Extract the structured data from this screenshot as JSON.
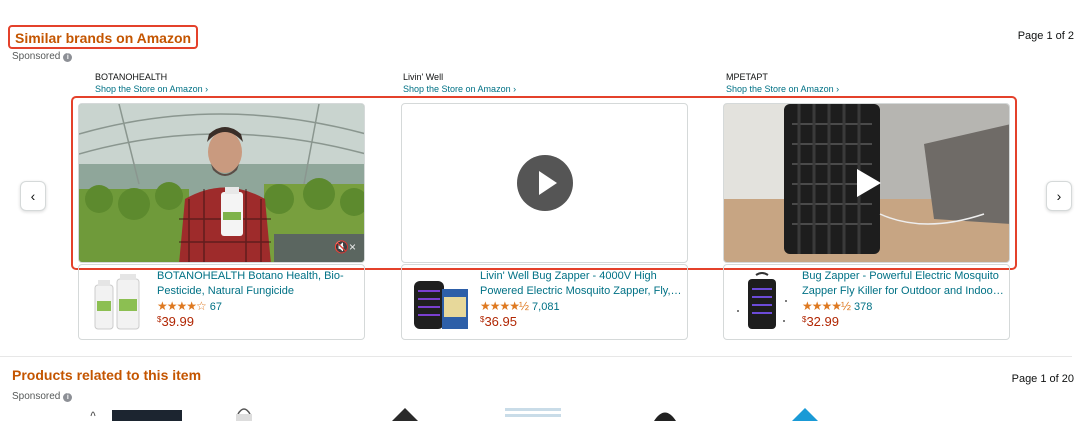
{
  "similar_brands": {
    "title": "Similar brands on Amazon",
    "sponsored": "Sponsored",
    "pager": "Page 1 of 2",
    "brands": [
      {
        "name": "BOTANOHEALTH",
        "store_link": "Shop the Store on Amazon ›",
        "product_title": "BOTANOHEALTH Botano Health, Bio-Pesticide, Natural Fungicide Insecticide…",
        "stars": "★★★★☆",
        "rating_count": "67",
        "price_symbol": "$",
        "price": "39.99"
      },
      {
        "name": "Livin' Well",
        "store_link": "Shop the Store on Amazon ›",
        "product_title": "Livin' Well Bug Zapper - 4000V High Powered Electric Mosquito Zapper, Fly,…",
        "stars": "★★★★½",
        "rating_count": "7,081",
        "price_symbol": "$",
        "price": "36.95"
      },
      {
        "name": "MPETAPT",
        "store_link": "Shop the Store on Amazon ›",
        "product_title": "Bug Zapper - Powerful Electric Mosquito Zapper Fly Killer for Outdoor and Indoo…",
        "stars": "★★★★½",
        "rating_count": "378",
        "price_symbol": "$",
        "price": "32.99"
      }
    ],
    "mute_icon": "🔇×"
  },
  "related": {
    "title": "Products related to this item",
    "sponsored": "Sponsored",
    "pager": "Page 1 of 20"
  },
  "nav": {
    "prev": "‹",
    "next": "›"
  },
  "colors": {
    "section_title": "#c45500",
    "link": "#007185",
    "price": "#b12704",
    "star": "#de7921",
    "highlight": "#e4412b"
  }
}
